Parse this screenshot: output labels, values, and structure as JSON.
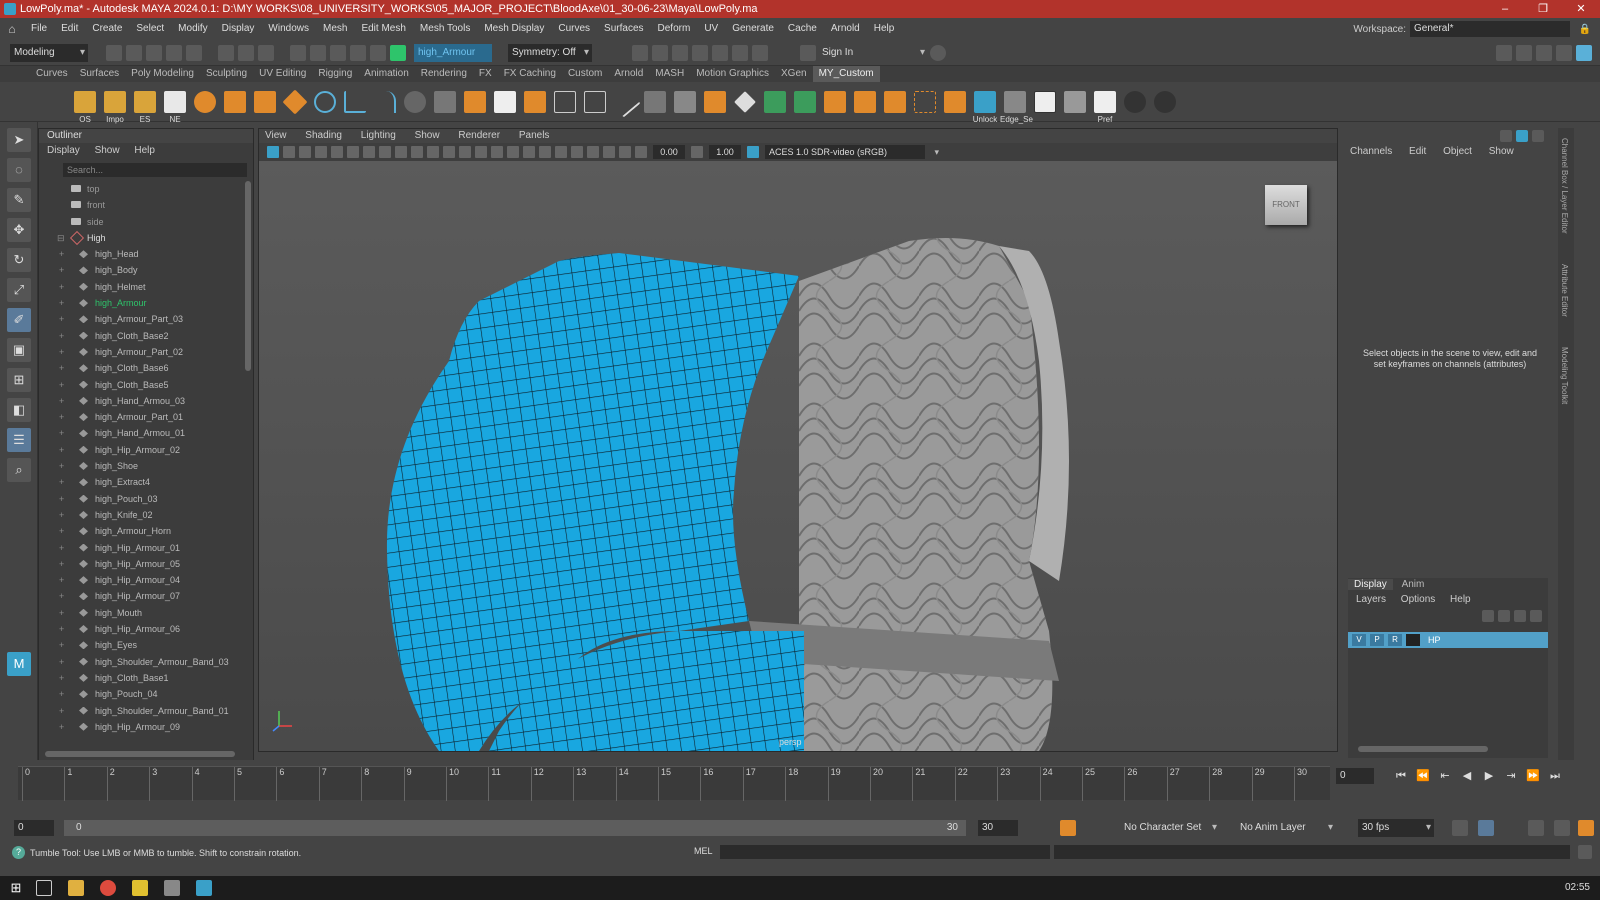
{
  "titlebar": {
    "title": "LowPoly.ma* - Autodesk MAYA 2024.0.1: D:\\MY WORKS\\08_UNIVERSITY_WORKS\\05_MAJOR_PROJECT\\BloodAxe\\01_30-06-23\\Maya\\LowPoly.ma",
    "minimize": "–",
    "restore": "❐",
    "close": "✕"
  },
  "menubar": {
    "items": [
      "File",
      "Edit",
      "Create",
      "Select",
      "Modify",
      "Display",
      "Windows",
      "Mesh",
      "Edit Mesh",
      "Mesh Tools",
      "Mesh Display",
      "Curves",
      "Surfaces",
      "Deform",
      "UV",
      "Generate",
      "Cache",
      "Arnold",
      "Help"
    ],
    "workspace_label": "Workspace:",
    "workspace_value": "General*"
  },
  "statusline": {
    "mode": "Modeling",
    "object_field": "high_Armour",
    "symmetry": "Symmetry: Off",
    "sign_in": "Sign In"
  },
  "shelf": {
    "tabs": [
      "Curves",
      "Surfaces",
      "Poly Modeling",
      "Sculpting",
      "UV Editing",
      "Rigging",
      "Animation",
      "Rendering",
      "FX",
      "FX Caching",
      "Custom",
      "Arnold",
      "MASH",
      "Motion Graphics",
      "XGen",
      "MY_Custom"
    ],
    "active_tab": "MY_Custom",
    "labels": [
      "OS",
      "Impo",
      "ES",
      "NE",
      "Unlock",
      "Edge_Se",
      "Pref"
    ]
  },
  "outliner": {
    "title": "Outliner",
    "menu": [
      "Display",
      "Show",
      "Help"
    ],
    "search_placeholder": "Search...",
    "cameras": [
      "top",
      "front",
      "side"
    ],
    "group": "High",
    "items": [
      "high_Head",
      "high_Body",
      "high_Helmet",
      "high_Armour",
      "high_Armour_Part_03",
      "high_Cloth_Base2",
      "high_Armour_Part_02",
      "high_Cloth_Base6",
      "high_Cloth_Base5",
      "high_Hand_Armou_03",
      "high_Armour_Part_01",
      "high_Hand_Armou_01",
      "high_Hip_Armour_02",
      "high_Shoe",
      "high_Extract4",
      "high_Pouch_03",
      "high_Knife_02",
      "high_Armour_Horn",
      "high_Hip_Armour_01",
      "high_Hip_Armour_05",
      "high_Hip_Armour_04",
      "high_Hip_Armour_07",
      "high_Mouth",
      "high_Hip_Armour_06",
      "high_Eyes",
      "high_Shoulder_Armour_Band_03",
      "high_Cloth_Base1",
      "high_Pouch_04",
      "high_Shoulder_Armour_Band_01",
      "high_Hip_Armour_09"
    ],
    "selected": "high_Armour"
  },
  "viewport": {
    "menu": [
      "View",
      "Shading",
      "Lighting",
      "Show",
      "Renderer",
      "Panels"
    ],
    "exposure": "0.00",
    "gamma": "1.00",
    "color_space": "ACES 1.0 SDR-video (sRGB)",
    "view_cube": "FRONT",
    "camera": "persp"
  },
  "channelbox": {
    "menu": [
      "Channels",
      "Edit",
      "Object",
      "Show"
    ],
    "hint": "Select objects in the scene to view, edit and set keyframes on channels (attributes)",
    "side_tabs": [
      "Channel Box / Layer Editor",
      "Attribute Editor",
      "Modeling Toolkit"
    ]
  },
  "layers": {
    "tabs": [
      "Display",
      "Anim"
    ],
    "menu": [
      "Layers",
      "Options",
      "Help"
    ],
    "layer": {
      "v": "V",
      "p": "P",
      "r": "R",
      "name": "HP"
    }
  },
  "timeline": {
    "ticks": [
      "0",
      "1",
      "2",
      "3",
      "4",
      "5",
      "6",
      "7",
      "8",
      "9",
      "10",
      "11",
      "12",
      "13",
      "14",
      "15",
      "16",
      "17",
      "18",
      "19",
      "20",
      "21",
      "22",
      "23",
      "24",
      "25",
      "26",
      "27",
      "28",
      "29",
      "30"
    ],
    "current_frame": "0",
    "playback": [
      "⏮",
      "⏪",
      "⇤",
      "◀",
      "▶",
      "⇥",
      "⏩",
      "⏭"
    ]
  },
  "range": {
    "start": "0",
    "inner_start": "0",
    "inner_end": "30",
    "end": "30",
    "character": "No Character Set",
    "anim_layer": "No Anim Layer",
    "fps": "30 fps"
  },
  "helpline": {
    "text": "Tumble Tool: Use LMB or MMB to tumble. Shift to constrain rotation.",
    "mel": "MEL"
  },
  "taskbar": {
    "clock": "02:55"
  },
  "colors": {
    "title_red": "#b2332b",
    "mesh_blue": "#19a7e0",
    "select_green": "#2ec46b",
    "layer_blue": "#52a0c8"
  }
}
